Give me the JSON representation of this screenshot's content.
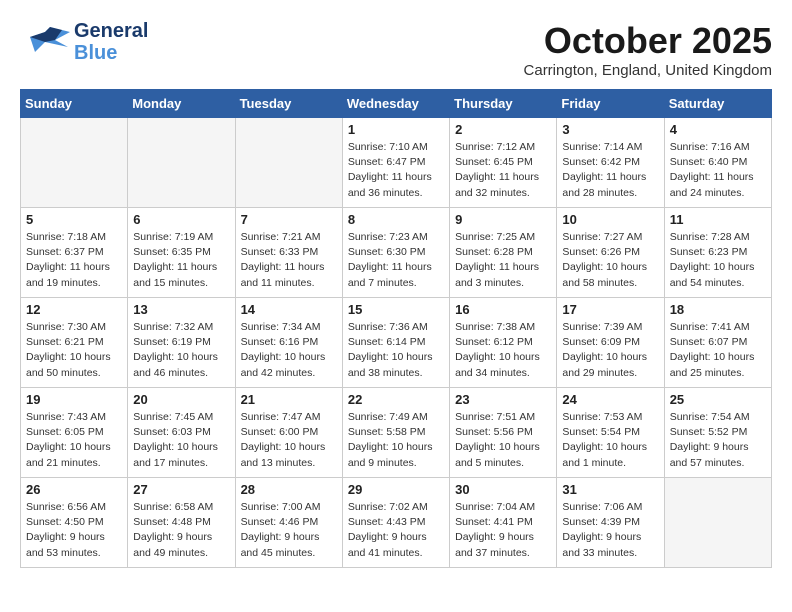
{
  "header": {
    "logo_general": "General",
    "logo_blue": "Blue",
    "month_title": "October 2025",
    "location": "Carrington, England, United Kingdom"
  },
  "days_of_week": [
    "Sunday",
    "Monday",
    "Tuesday",
    "Wednesday",
    "Thursday",
    "Friday",
    "Saturday"
  ],
  "weeks": [
    [
      {
        "day": "",
        "info": ""
      },
      {
        "day": "",
        "info": ""
      },
      {
        "day": "",
        "info": ""
      },
      {
        "day": "1",
        "info": "Sunrise: 7:10 AM\nSunset: 6:47 PM\nDaylight: 11 hours\nand 36 minutes."
      },
      {
        "day": "2",
        "info": "Sunrise: 7:12 AM\nSunset: 6:45 PM\nDaylight: 11 hours\nand 32 minutes."
      },
      {
        "day": "3",
        "info": "Sunrise: 7:14 AM\nSunset: 6:42 PM\nDaylight: 11 hours\nand 28 minutes."
      },
      {
        "day": "4",
        "info": "Sunrise: 7:16 AM\nSunset: 6:40 PM\nDaylight: 11 hours\nand 24 minutes."
      }
    ],
    [
      {
        "day": "5",
        "info": "Sunrise: 7:18 AM\nSunset: 6:37 PM\nDaylight: 11 hours\nand 19 minutes."
      },
      {
        "day": "6",
        "info": "Sunrise: 7:19 AM\nSunset: 6:35 PM\nDaylight: 11 hours\nand 15 minutes."
      },
      {
        "day": "7",
        "info": "Sunrise: 7:21 AM\nSunset: 6:33 PM\nDaylight: 11 hours\nand 11 minutes."
      },
      {
        "day": "8",
        "info": "Sunrise: 7:23 AM\nSunset: 6:30 PM\nDaylight: 11 hours\nand 7 minutes."
      },
      {
        "day": "9",
        "info": "Sunrise: 7:25 AM\nSunset: 6:28 PM\nDaylight: 11 hours\nand 3 minutes."
      },
      {
        "day": "10",
        "info": "Sunrise: 7:27 AM\nSunset: 6:26 PM\nDaylight: 10 hours\nand 58 minutes."
      },
      {
        "day": "11",
        "info": "Sunrise: 7:28 AM\nSunset: 6:23 PM\nDaylight: 10 hours\nand 54 minutes."
      }
    ],
    [
      {
        "day": "12",
        "info": "Sunrise: 7:30 AM\nSunset: 6:21 PM\nDaylight: 10 hours\nand 50 minutes."
      },
      {
        "day": "13",
        "info": "Sunrise: 7:32 AM\nSunset: 6:19 PM\nDaylight: 10 hours\nand 46 minutes."
      },
      {
        "day": "14",
        "info": "Sunrise: 7:34 AM\nSunset: 6:16 PM\nDaylight: 10 hours\nand 42 minutes."
      },
      {
        "day": "15",
        "info": "Sunrise: 7:36 AM\nSunset: 6:14 PM\nDaylight: 10 hours\nand 38 minutes."
      },
      {
        "day": "16",
        "info": "Sunrise: 7:38 AM\nSunset: 6:12 PM\nDaylight: 10 hours\nand 34 minutes."
      },
      {
        "day": "17",
        "info": "Sunrise: 7:39 AM\nSunset: 6:09 PM\nDaylight: 10 hours\nand 29 minutes."
      },
      {
        "day": "18",
        "info": "Sunrise: 7:41 AM\nSunset: 6:07 PM\nDaylight: 10 hours\nand 25 minutes."
      }
    ],
    [
      {
        "day": "19",
        "info": "Sunrise: 7:43 AM\nSunset: 6:05 PM\nDaylight: 10 hours\nand 21 minutes."
      },
      {
        "day": "20",
        "info": "Sunrise: 7:45 AM\nSunset: 6:03 PM\nDaylight: 10 hours\nand 17 minutes."
      },
      {
        "day": "21",
        "info": "Sunrise: 7:47 AM\nSunset: 6:00 PM\nDaylight: 10 hours\nand 13 minutes."
      },
      {
        "day": "22",
        "info": "Sunrise: 7:49 AM\nSunset: 5:58 PM\nDaylight: 10 hours\nand 9 minutes."
      },
      {
        "day": "23",
        "info": "Sunrise: 7:51 AM\nSunset: 5:56 PM\nDaylight: 10 hours\nand 5 minutes."
      },
      {
        "day": "24",
        "info": "Sunrise: 7:53 AM\nSunset: 5:54 PM\nDaylight: 10 hours\nand 1 minute."
      },
      {
        "day": "25",
        "info": "Sunrise: 7:54 AM\nSunset: 5:52 PM\nDaylight: 9 hours\nand 57 minutes."
      }
    ],
    [
      {
        "day": "26",
        "info": "Sunrise: 6:56 AM\nSunset: 4:50 PM\nDaylight: 9 hours\nand 53 minutes."
      },
      {
        "day": "27",
        "info": "Sunrise: 6:58 AM\nSunset: 4:48 PM\nDaylight: 9 hours\nand 49 minutes."
      },
      {
        "day": "28",
        "info": "Sunrise: 7:00 AM\nSunset: 4:46 PM\nDaylight: 9 hours\nand 45 minutes."
      },
      {
        "day": "29",
        "info": "Sunrise: 7:02 AM\nSunset: 4:43 PM\nDaylight: 9 hours\nand 41 minutes."
      },
      {
        "day": "30",
        "info": "Sunrise: 7:04 AM\nSunset: 4:41 PM\nDaylight: 9 hours\nand 37 minutes."
      },
      {
        "day": "31",
        "info": "Sunrise: 7:06 AM\nSunset: 4:39 PM\nDaylight: 9 hours\nand 33 minutes."
      },
      {
        "day": "",
        "info": ""
      }
    ]
  ]
}
